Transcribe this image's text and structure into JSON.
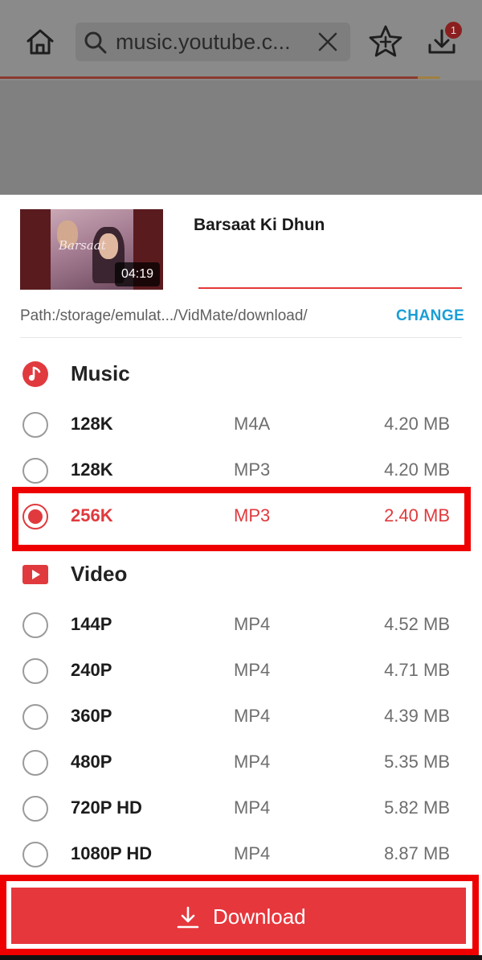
{
  "browser": {
    "url": "music.youtube.c...",
    "download_badge": "1"
  },
  "video": {
    "title": "Barsaat Ki Dhun",
    "duration": "04:19",
    "poster_title": "Barsaat"
  },
  "path": {
    "label": "Path:/storage/emulat.../VidMate/download/",
    "change_label": "CHANGE"
  },
  "music": {
    "label": "Music",
    "options": [
      {
        "quality": "128K",
        "format": "M4A",
        "size": "4.20 MB",
        "selected": false
      },
      {
        "quality": "128K",
        "format": "MP3",
        "size": "4.20 MB",
        "selected": false
      },
      {
        "quality": "256K",
        "format": "MP3",
        "size": "2.40 MB",
        "selected": true
      }
    ]
  },
  "video_section": {
    "label": "Video",
    "options": [
      {
        "quality": "144P",
        "format": "MP4",
        "size": "4.52 MB",
        "selected": false
      },
      {
        "quality": "240P",
        "format": "MP4",
        "size": "4.71 MB",
        "selected": false
      },
      {
        "quality": "360P",
        "format": "MP4",
        "size": "4.39 MB",
        "selected": false
      },
      {
        "quality": "480P",
        "format": "MP4",
        "size": "5.35 MB",
        "selected": false
      },
      {
        "quality": "720P HD",
        "format": "MP4",
        "size": "5.82 MB",
        "selected": false
      },
      {
        "quality": "1080P HD",
        "format": "MP4",
        "size": "8.87 MB",
        "selected": false
      }
    ]
  },
  "download_button": {
    "label": "Download"
  },
  "colors": {
    "accent": "#e03a3e",
    "highlight": "#ee0000",
    "link": "#1a9ed6"
  },
  "icons": {
    "home": "home-icon",
    "search": "search-icon",
    "clear": "close-icon",
    "bookmark": "star-plus-icon",
    "downloads": "download-icon",
    "music": "music-note-icon",
    "video": "video-play-icon"
  }
}
